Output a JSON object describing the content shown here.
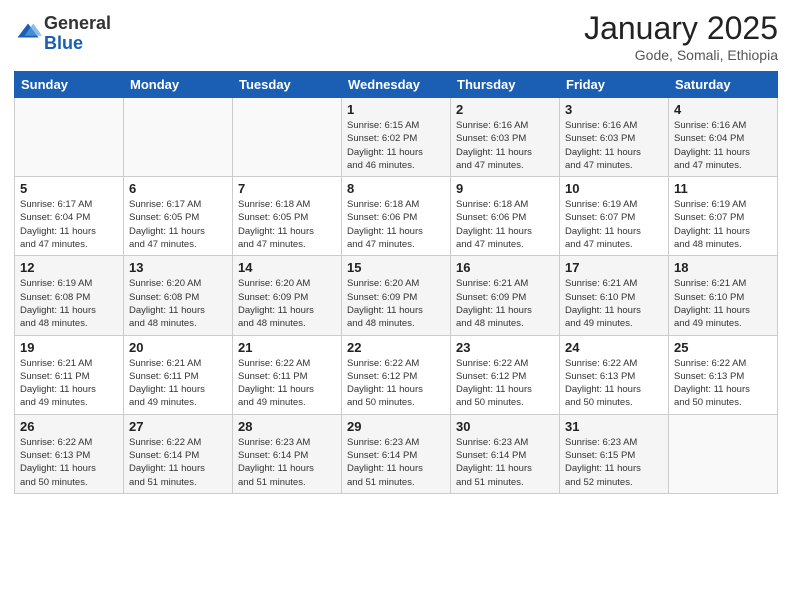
{
  "header": {
    "logo_general": "General",
    "logo_blue": "Blue",
    "month_title": "January 2025",
    "subtitle": "Gode, Somali, Ethiopia"
  },
  "calendar": {
    "days": [
      "Sunday",
      "Monday",
      "Tuesday",
      "Wednesday",
      "Thursday",
      "Friday",
      "Saturday"
    ],
    "weeks": [
      [
        {
          "day": "",
          "info": ""
        },
        {
          "day": "",
          "info": ""
        },
        {
          "day": "",
          "info": ""
        },
        {
          "day": "1",
          "info": "Sunrise: 6:15 AM\nSunset: 6:02 PM\nDaylight: 11 hours\nand 46 minutes."
        },
        {
          "day": "2",
          "info": "Sunrise: 6:16 AM\nSunset: 6:03 PM\nDaylight: 11 hours\nand 47 minutes."
        },
        {
          "day": "3",
          "info": "Sunrise: 6:16 AM\nSunset: 6:03 PM\nDaylight: 11 hours\nand 47 minutes."
        },
        {
          "day": "4",
          "info": "Sunrise: 6:16 AM\nSunset: 6:04 PM\nDaylight: 11 hours\nand 47 minutes."
        }
      ],
      [
        {
          "day": "5",
          "info": "Sunrise: 6:17 AM\nSunset: 6:04 PM\nDaylight: 11 hours\nand 47 minutes."
        },
        {
          "day": "6",
          "info": "Sunrise: 6:17 AM\nSunset: 6:05 PM\nDaylight: 11 hours\nand 47 minutes."
        },
        {
          "day": "7",
          "info": "Sunrise: 6:18 AM\nSunset: 6:05 PM\nDaylight: 11 hours\nand 47 minutes."
        },
        {
          "day": "8",
          "info": "Sunrise: 6:18 AM\nSunset: 6:06 PM\nDaylight: 11 hours\nand 47 minutes."
        },
        {
          "day": "9",
          "info": "Sunrise: 6:18 AM\nSunset: 6:06 PM\nDaylight: 11 hours\nand 47 minutes."
        },
        {
          "day": "10",
          "info": "Sunrise: 6:19 AM\nSunset: 6:07 PM\nDaylight: 11 hours\nand 47 minutes."
        },
        {
          "day": "11",
          "info": "Sunrise: 6:19 AM\nSunset: 6:07 PM\nDaylight: 11 hours\nand 48 minutes."
        }
      ],
      [
        {
          "day": "12",
          "info": "Sunrise: 6:19 AM\nSunset: 6:08 PM\nDaylight: 11 hours\nand 48 minutes."
        },
        {
          "day": "13",
          "info": "Sunrise: 6:20 AM\nSunset: 6:08 PM\nDaylight: 11 hours\nand 48 minutes."
        },
        {
          "day": "14",
          "info": "Sunrise: 6:20 AM\nSunset: 6:09 PM\nDaylight: 11 hours\nand 48 minutes."
        },
        {
          "day": "15",
          "info": "Sunrise: 6:20 AM\nSunset: 6:09 PM\nDaylight: 11 hours\nand 48 minutes."
        },
        {
          "day": "16",
          "info": "Sunrise: 6:21 AM\nSunset: 6:09 PM\nDaylight: 11 hours\nand 48 minutes."
        },
        {
          "day": "17",
          "info": "Sunrise: 6:21 AM\nSunset: 6:10 PM\nDaylight: 11 hours\nand 49 minutes."
        },
        {
          "day": "18",
          "info": "Sunrise: 6:21 AM\nSunset: 6:10 PM\nDaylight: 11 hours\nand 49 minutes."
        }
      ],
      [
        {
          "day": "19",
          "info": "Sunrise: 6:21 AM\nSunset: 6:11 PM\nDaylight: 11 hours\nand 49 minutes."
        },
        {
          "day": "20",
          "info": "Sunrise: 6:21 AM\nSunset: 6:11 PM\nDaylight: 11 hours\nand 49 minutes."
        },
        {
          "day": "21",
          "info": "Sunrise: 6:22 AM\nSunset: 6:11 PM\nDaylight: 11 hours\nand 49 minutes."
        },
        {
          "day": "22",
          "info": "Sunrise: 6:22 AM\nSunset: 6:12 PM\nDaylight: 11 hours\nand 50 minutes."
        },
        {
          "day": "23",
          "info": "Sunrise: 6:22 AM\nSunset: 6:12 PM\nDaylight: 11 hours\nand 50 minutes."
        },
        {
          "day": "24",
          "info": "Sunrise: 6:22 AM\nSunset: 6:13 PM\nDaylight: 11 hours\nand 50 minutes."
        },
        {
          "day": "25",
          "info": "Sunrise: 6:22 AM\nSunset: 6:13 PM\nDaylight: 11 hours\nand 50 minutes."
        }
      ],
      [
        {
          "day": "26",
          "info": "Sunrise: 6:22 AM\nSunset: 6:13 PM\nDaylight: 11 hours\nand 50 minutes."
        },
        {
          "day": "27",
          "info": "Sunrise: 6:22 AM\nSunset: 6:14 PM\nDaylight: 11 hours\nand 51 minutes."
        },
        {
          "day": "28",
          "info": "Sunrise: 6:23 AM\nSunset: 6:14 PM\nDaylight: 11 hours\nand 51 minutes."
        },
        {
          "day": "29",
          "info": "Sunrise: 6:23 AM\nSunset: 6:14 PM\nDaylight: 11 hours\nand 51 minutes."
        },
        {
          "day": "30",
          "info": "Sunrise: 6:23 AM\nSunset: 6:14 PM\nDaylight: 11 hours\nand 51 minutes."
        },
        {
          "day": "31",
          "info": "Sunrise: 6:23 AM\nSunset: 6:15 PM\nDaylight: 11 hours\nand 52 minutes."
        },
        {
          "day": "",
          "info": ""
        }
      ]
    ]
  }
}
